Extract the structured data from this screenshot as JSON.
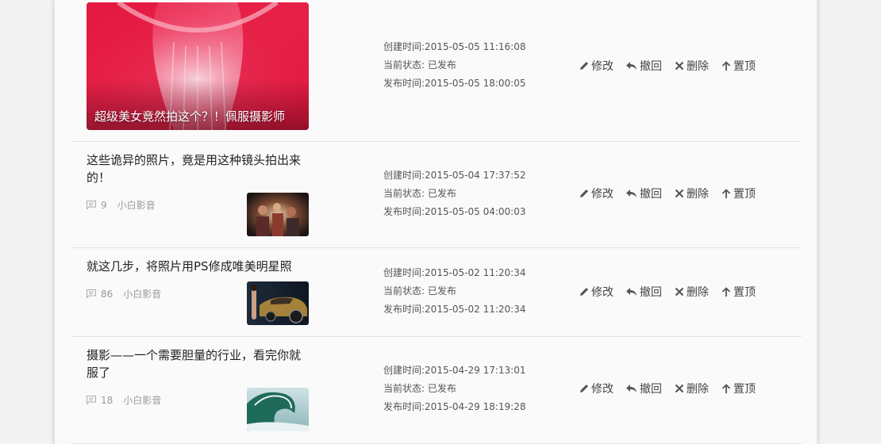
{
  "actions": {
    "edit": "修改",
    "withdraw": "撤回",
    "delete": "删除",
    "pin": "置顶"
  },
  "articles": [
    {
      "title": "超级美女竟然拍这个？！佩服摄影师",
      "created": "创建时间:2015-05-05 11:16:08",
      "status": "当前状态: 已发布",
      "published": "发布时间:2015-05-05 18:00:05"
    },
    {
      "title": "这些诡异的照片，竟是用这种镜头拍出来的！",
      "comments": "9",
      "author": "小白影音",
      "created": "创建时间:2015-05-04 17:37:52",
      "status": "当前状态: 已发布",
      "published": "发布时间:2015-05-05 04:00:03"
    },
    {
      "title": "就这几步，将照片用PS修成唯美明星照",
      "comments": "86",
      "author": "小白影音",
      "created": "创建时间:2015-05-02 11:20:34",
      "status": "当前状态: 已发布",
      "published": "发布时间:2015-05-02 11:20:34"
    },
    {
      "title": "摄影——一个需要胆量的行业，看完你就服了",
      "comments": "18",
      "author": "小白影音",
      "created": "创建时间:2015-04-29 17:13:01",
      "status": "当前状态: 已发布",
      "published": "发布时间:2015-04-29 18:19:28"
    }
  ]
}
